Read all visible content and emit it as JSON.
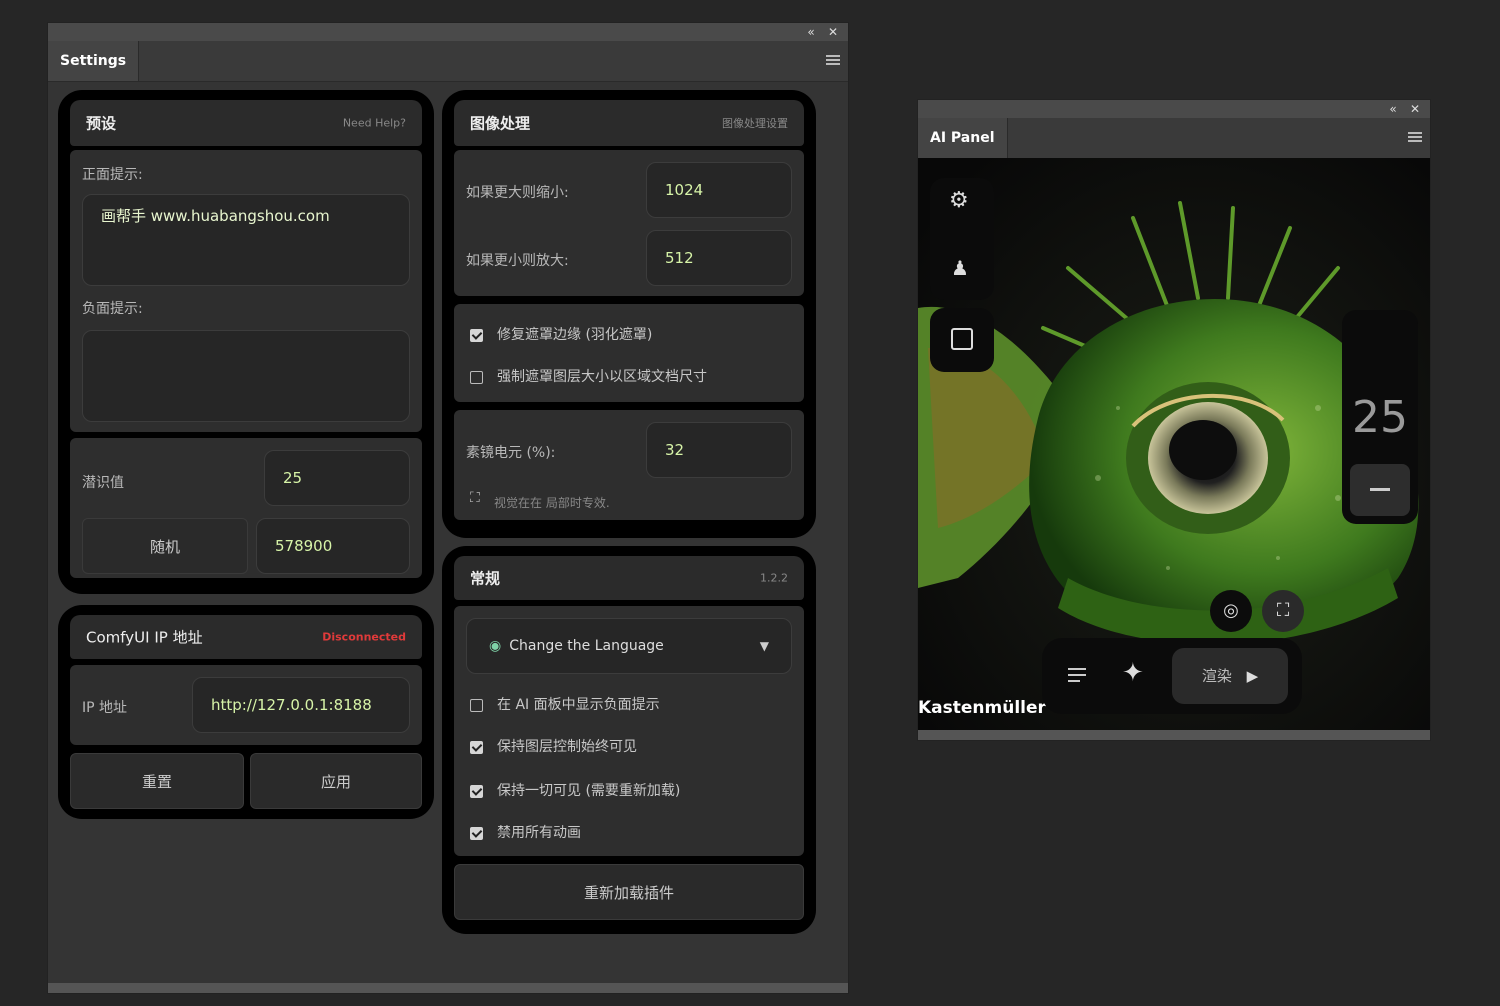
{
  "settings": {
    "tab": "Settings",
    "preset": {
      "title": "预设",
      "help": "Need Help?",
      "positive_label": "正面提示:",
      "positive_value": "画帮手 www.huabangshou.com",
      "negative_label": "负面提示:",
      "negative_value": "",
      "steps_label": "潜识值",
      "steps_value": "25",
      "random_label": "随机",
      "seed_value": "578900"
    },
    "comfy": {
      "title": "ComfyUI IP 地址",
      "status": "Disconnected",
      "status_color": "#e03a3a",
      "ip_label": "IP 地址",
      "ip_value": "http://127.0.0.1:8188",
      "reset_label": "重置",
      "apply_label": "应用"
    },
    "image": {
      "title": "图像处理",
      "right": "图像处理设置",
      "shrink_label": "如果更大则缩小:",
      "shrink_value": "1024",
      "enlarge_label": "如果更小则放大:",
      "enlarge_value": "512",
      "check1": "修复遮罩边缘 (羽化遮罩)",
      "check2": "强制遮罩图层大小以区域文档尺寸",
      "pixel_label": "素镜电元 (%):",
      "pixel_value": "32",
      "note": "视觉在在 局部时专效."
    },
    "general": {
      "title": "常规",
      "version": "1.2.2",
      "lang_label": "Change the Language",
      "opt1": "在 AI 面板中显示负面提示",
      "opt2": "保持图层控制始终可见",
      "opt3": "保持一切可见 (需要重新加载)",
      "opt4": "禁用所有动画",
      "reload_label": "重新加载插件"
    }
  },
  "ai_panel": {
    "tab": "AI Panel",
    "watermark": "Kastenmüller",
    "counter": "25",
    "render_label": "渲染",
    "colors": {
      "accent": "#d7f4a8"
    }
  }
}
